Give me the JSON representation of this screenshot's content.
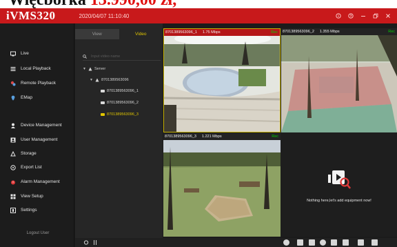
{
  "banner": {
    "part1": "Więcborka",
    "part2": "13.990,00 zł,"
  },
  "window": {
    "app_title": "iVMS320",
    "datetime": "2020/04/07 11:10:40"
  },
  "titlebar_icons": [
    "info-icon",
    "help-icon",
    "minimize-icon",
    "restore-icon",
    "close-icon"
  ],
  "nav": {
    "items": [
      {
        "label": "Live",
        "icon": "monitor-icon"
      },
      {
        "label": "Local Playback",
        "icon": "playback-icon"
      },
      {
        "label": "Remote Playback",
        "icon": "remote-playback-icon"
      },
      {
        "label": "EMap",
        "icon": "map-icon"
      },
      {
        "label": "Device Management",
        "icon": "device-icon"
      },
      {
        "label": "User Management",
        "icon": "user-icon"
      },
      {
        "label": "Storage",
        "icon": "storage-icon"
      },
      {
        "label": "Export List",
        "icon": "export-icon"
      },
      {
        "label": "Alarm Management",
        "icon": "alarm-icon"
      },
      {
        "label": "View Setup",
        "icon": "view-setup-icon"
      },
      {
        "label": "Settings",
        "icon": "settings-icon"
      }
    ],
    "logout_label": "Logout User"
  },
  "tree": {
    "tabs": [
      {
        "label": "View",
        "active": false
      },
      {
        "label": "Video",
        "active": true
      }
    ],
    "search_placeholder": "Input video name",
    "server_label": "Server",
    "device_label": "8701389563096",
    "channels": [
      {
        "label": "8701389563096_1",
        "selected": false
      },
      {
        "label": "8701389563096_2",
        "selected": false
      },
      {
        "label": "8701389563096_3",
        "selected": true
      }
    ]
  },
  "video": {
    "cells": [
      {
        "name": "8701389563096_1",
        "rate": "1.75 Mbps",
        "status": "Rec"
      },
      {
        "name": "8701389563096_2",
        "rate": "1.355 Mbps",
        "status": "Rec"
      },
      {
        "name": "8701389563096_3",
        "rate": "1.221 Mbps",
        "status": "Rec"
      }
    ],
    "empty_message": "Nothing here,let's add equipment now!"
  },
  "toolbar_icons": [
    "snapshot-icon",
    "record-icon",
    "layout-icon",
    "camera-icon",
    "pause-icon",
    "play-icon",
    "stop-icon",
    "grid-icon"
  ],
  "colors": {
    "accent": "#c8191b",
    "selected": "#e1c600",
    "rec": "#00d000"
  }
}
